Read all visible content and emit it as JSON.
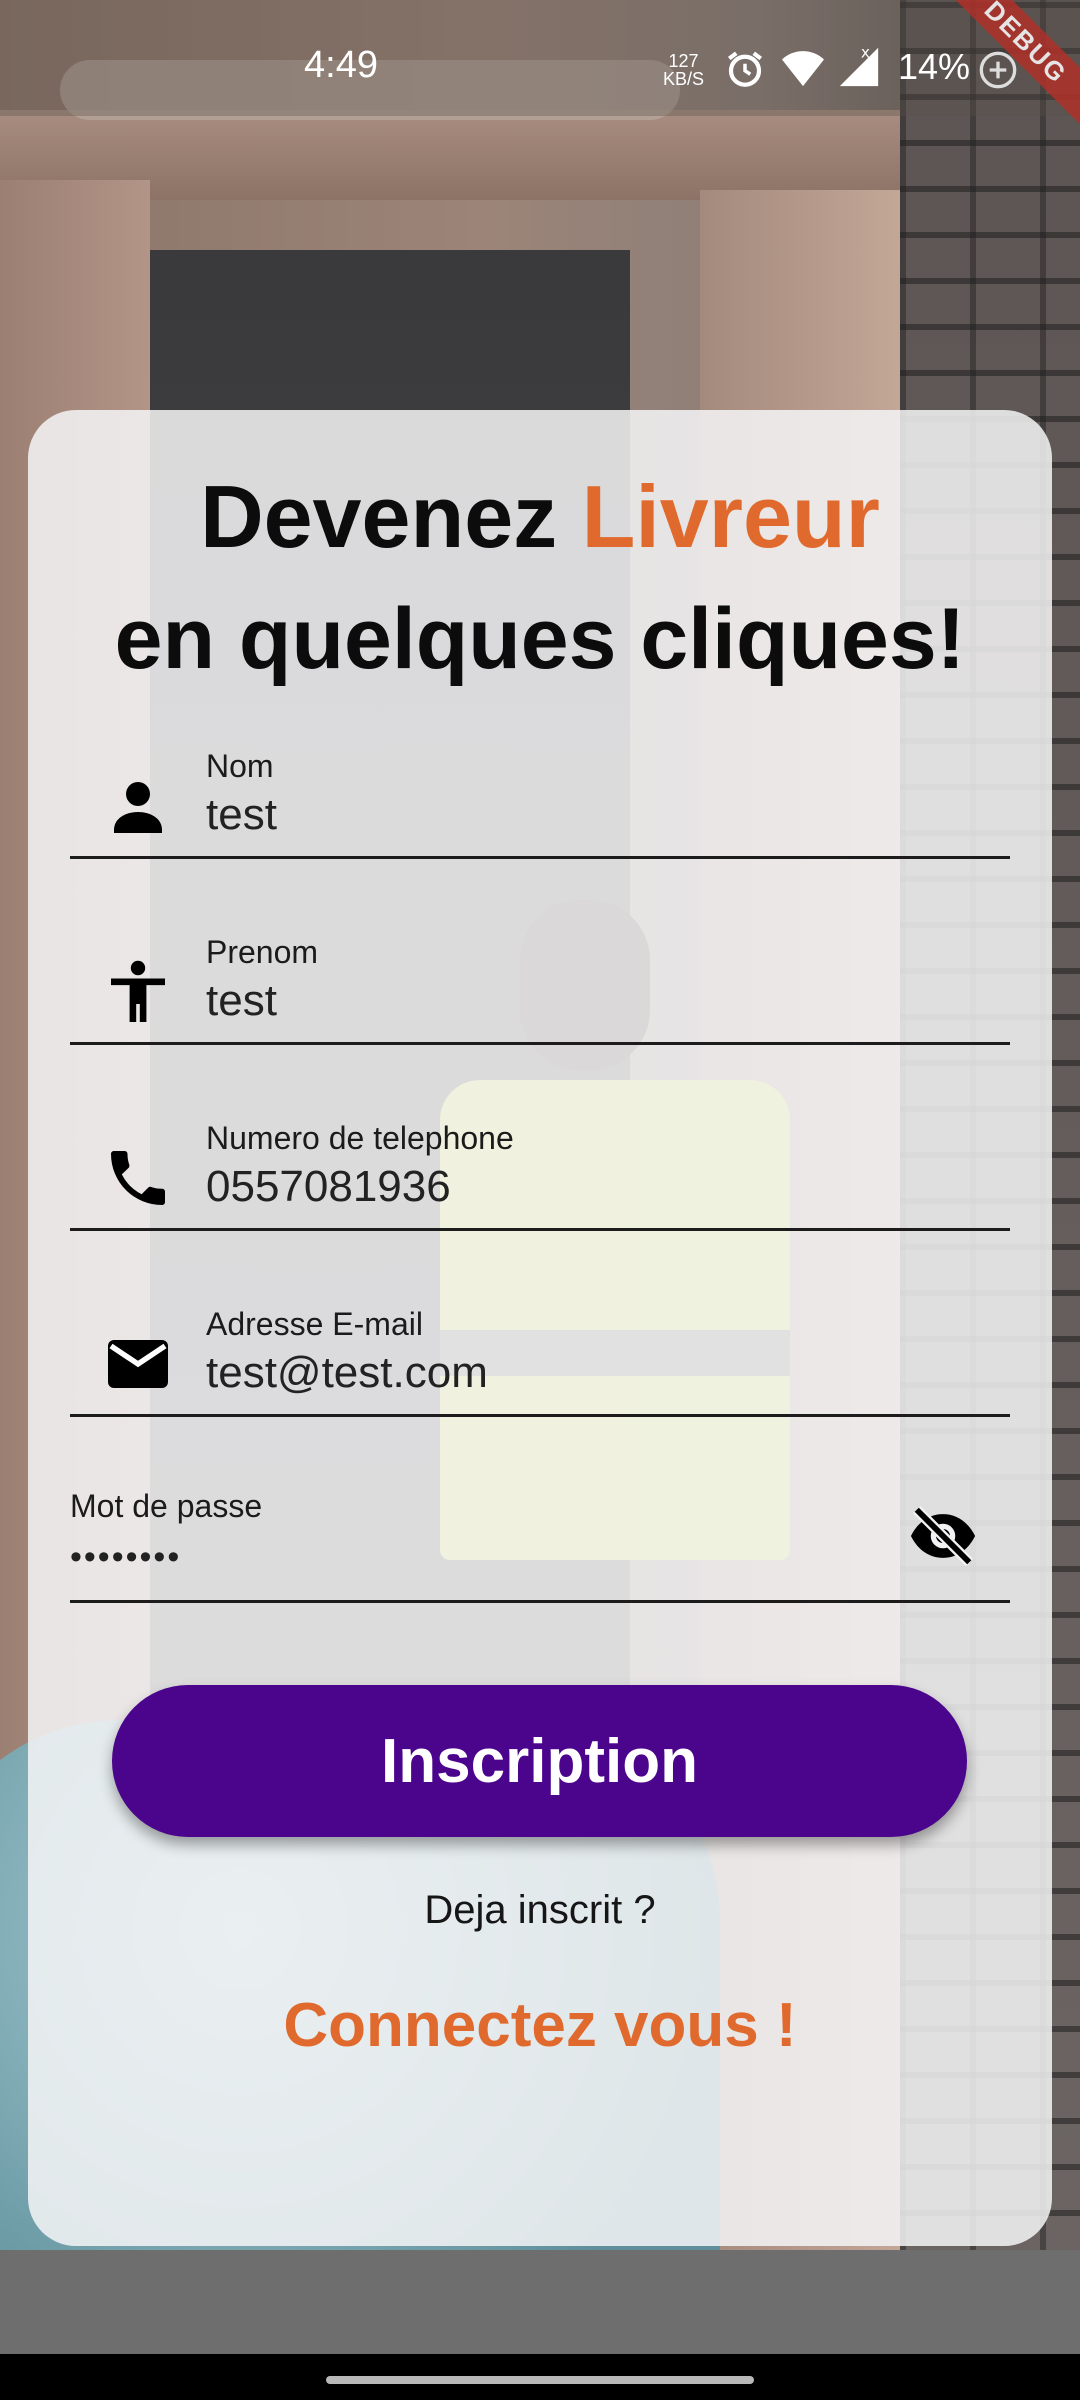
{
  "status_bar": {
    "time": "4:49",
    "net_speed_value": "127",
    "net_speed_unit": "KB/S",
    "battery": "14%",
    "debug_banner": "DEBUG"
  },
  "card": {
    "title_word1": "Devenez ",
    "title_word2": "Livreur",
    "title_line2": "en quelques cliques!",
    "accent_color": "#e06a2e"
  },
  "form": {
    "fields": [
      {
        "label": "Nom",
        "value": "test",
        "icon": "person-icon"
      },
      {
        "label": "Prenom",
        "value": "test",
        "icon": "accessibility-icon"
      },
      {
        "label": "Numero de telephone",
        "value": "0557081936",
        "icon": "phone-icon"
      },
      {
        "label": "Adresse E-mail",
        "value": "test@test.com",
        "icon": "email-icon"
      }
    ],
    "password": {
      "label": "Mot de passe",
      "value": "••••••••",
      "toggle_icon": "eye-off-icon"
    }
  },
  "actions": {
    "signup_label": "Inscription",
    "button_color": "#4b048c",
    "already_label": "Deja inscrit ?",
    "login_link": "Connectez vous !"
  }
}
